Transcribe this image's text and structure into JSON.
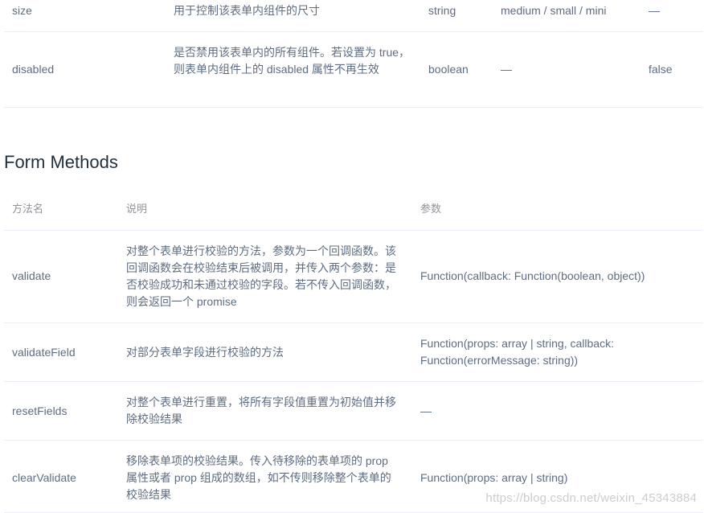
{
  "attributes_table": {
    "rows": [
      {
        "name": "size",
        "description": "用于控制该表单内组件的尺寸",
        "type": "string",
        "options": "medium / small / mini",
        "default": "—"
      },
      {
        "name": "disabled",
        "description": "是否禁用该表单内的所有组件。若设置为 true，则表单内组件上的 disabled 属性不再生效",
        "type": "boolean",
        "options": "—",
        "default": "false"
      }
    ]
  },
  "methods_section": {
    "title": "Form Methods",
    "headers": {
      "name": "方法名",
      "description": "说明",
      "args": "参数"
    },
    "rows": [
      {
        "name": "validate",
        "description": "对整个表单进行校验的方法，参数为一个回调函数。该回调函数会在校验结束后被调用，并传入两个参数：是否校验成功和未通过校验的字段。若不传入回调函数，则会返回一个 promise",
        "args": "Function(callback: Function(boolean, object))"
      },
      {
        "name": "validateField",
        "description": "对部分表单字段进行校验的方法",
        "args": "Function(props: array | string, callback: Function(errorMessage: string))"
      },
      {
        "name": "resetFields",
        "description": "对整个表单进行重置，将所有字段值重置为初始值并移除校验结果",
        "args": "—"
      },
      {
        "name": "clearValidate",
        "description": "移除表单项的校验结果。传入待移除的表单项的 prop 属性或者 prop 组成的数组，如不传则移除整个表单的校验结果",
        "args": "Function(props: array | string)"
      }
    ]
  },
  "watermark": "https://blog.csdn.net/weixin_45343884",
  "colors": {
    "text": "#5e6d82",
    "heading": "#1f2f3d",
    "header_text": "#909399",
    "border": "#eaeefb"
  }
}
